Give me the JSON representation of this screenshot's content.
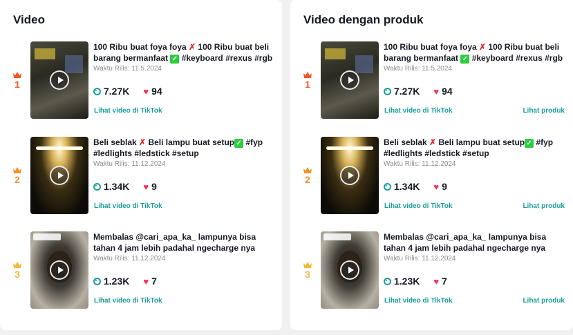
{
  "panels": [
    {
      "title": "Video",
      "rows": [
        {
          "rank": "1",
          "caption_a": "100 Ribu buat foya foya ",
          "x": "✗",
          "caption_b": " 100 Ribu buat beli barang bermanfaat ",
          "check": "✓",
          "caption_c": " #keyboard #rexus #rgb",
          "date": "Waktu Rilis: 11.5.2024",
          "views": "7.27K",
          "likes": "94",
          "link_video": "Lihat video di TikTok",
          "link_product": ""
        },
        {
          "rank": "2",
          "caption_a": "Beli seblak ",
          "x": "✗",
          "caption_b": " Beli lampu buat setup",
          "check": "✓",
          "caption_c": " #fyp #ledlights #ledstick #setup",
          "date": "Waktu Rilis: 11.12.2024",
          "views": "1.34K",
          "likes": "9",
          "link_video": "Lihat video di TikTok",
          "link_product": ""
        },
        {
          "rank": "3",
          "caption_a": "Membalas @cari_apa_ka_ lampunya bisa tahan 4 jam lebih padahal ngecharge nya cuman...",
          "x": "",
          "caption_b": "",
          "check": "",
          "caption_c": "",
          "date": "Waktu Rilis: 11.12.2024",
          "views": "1.23K",
          "likes": "7",
          "link_video": "Lihat video di TikTok",
          "link_product": ""
        }
      ]
    },
    {
      "title": "Video dengan produk",
      "rows": [
        {
          "rank": "1",
          "caption_a": "100 Ribu buat foya foya ",
          "x": "✗",
          "caption_b": " 100 Ribu buat beli barang bermanfaat ",
          "check": "✓",
          "caption_c": " #keyboard #rexus #rgb",
          "date": "Waktu Rilis: 11.5.2024",
          "views": "7.27K",
          "likes": "94",
          "link_video": "Lihat video di TikTok",
          "link_product": "Lihat produk"
        },
        {
          "rank": "2",
          "caption_a": "Beli seblak ",
          "x": "✗",
          "caption_b": " Beli lampu buat setup",
          "check": "✓",
          "caption_c": " #fyp #ledlights #ledstick #setup",
          "date": "Waktu Rilis: 11.12.2024",
          "views": "1.34K",
          "likes": "9",
          "link_video": "Lihat video di TikTok",
          "link_product": "Lihat produk"
        },
        {
          "rank": "3",
          "caption_a": "Membalas @cari_apa_ka_ lampunya bisa tahan 4 jam lebih padahal ngecharge nya cuman...",
          "x": "",
          "caption_b": "",
          "check": "",
          "caption_c": "",
          "date": "Waktu Rilis: 11.12.2024",
          "views": "1.23K",
          "likes": "7",
          "link_video": "Lihat video di TikTok",
          "link_product": "Lihat produk"
        }
      ]
    }
  ],
  "colors": {
    "accent": "#1a9e9a",
    "heart": "#fe2c55",
    "rank1": "#ee5a24",
    "rank2": "#f0932b",
    "rank3": "#f6b93b"
  },
  "icons": {
    "views": "eye-icon",
    "likes": "heart-icon",
    "rank": "crown-icon",
    "play": "play-icon"
  }
}
